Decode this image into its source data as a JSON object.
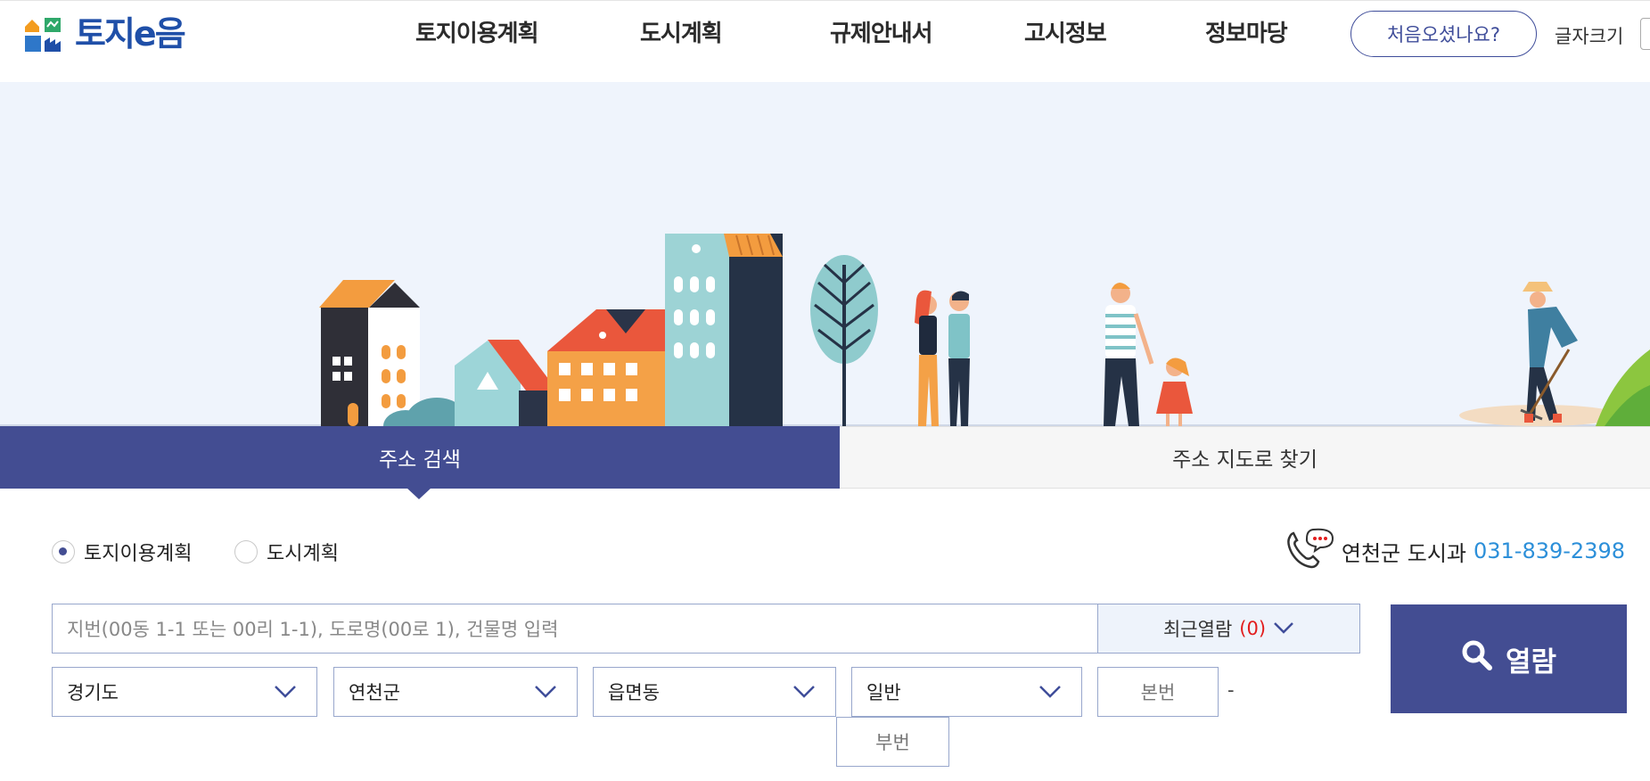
{
  "header": {
    "logo_text": "토지e음",
    "nav": [
      "토지이용계획",
      "도시계획",
      "규제안내서",
      "고시정보",
      "정보마당"
    ],
    "first_visit_button": "처음오셨나요?",
    "font_size_label": "글자크기"
  },
  "tabs": {
    "active": "주소 검색",
    "inactive": "주소 지도로 찾기"
  },
  "search": {
    "radio_options": [
      {
        "label": "토지이용계획",
        "selected": true
      },
      {
        "label": "도시계획",
        "selected": false
      }
    ],
    "contact": {
      "department": "연천군 도시과",
      "phone": "031-839-2398"
    },
    "input_placeholder": "지번(00동 1-1 또는 00리 1-1), 도로명(00로 1), 건물명 입력",
    "recent_label": "최근열람",
    "recent_count": "(0)",
    "view_button": "열람",
    "selects": {
      "province": "경기도",
      "county": "연천군",
      "town": "읍면동",
      "land_type": "일반"
    },
    "main_number": "본번",
    "dash": "-",
    "sub_number": "부번"
  },
  "colors": {
    "primary": "#434d92",
    "phone_blue": "#2c8fd9",
    "count_red": "#e21d1d",
    "hero_bg": "#eff4fc"
  }
}
